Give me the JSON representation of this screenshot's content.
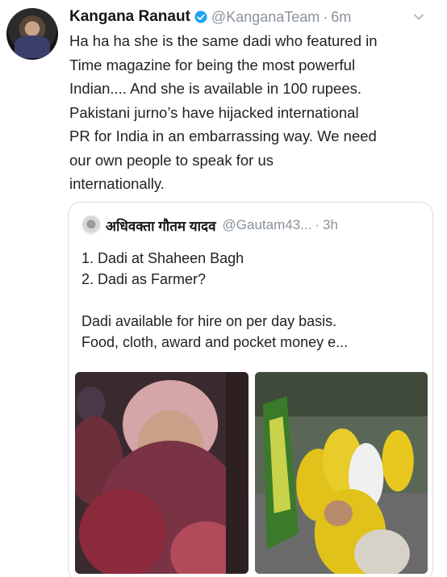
{
  "tweet": {
    "author_name": "Kangana Ranaut",
    "author_handle": "@KanganaTeam",
    "separator": "·",
    "time": "6m",
    "text_lines": [
      "Ha ha ha she is the same dadi who featured in",
      "Time magazine for being the most powerful",
      "Indian.... And she is available in 100 rupees.",
      "Pakistani jurno’s have hijacked international",
      "PR for India in an embarrassing way. We need",
      "our own people to speak for us",
      "internationally."
    ]
  },
  "quoted": {
    "author_name": "अधिवक्ता गौतम यादव",
    "author_handle": "@Gautam43...",
    "separator": "·",
    "time": "3h",
    "lines": [
      "1. Dadi at Shaheen Bagh",
      "2. Dadi as Farmer?",
      "",
      "Dadi available for hire on per day basis.",
      "Food, cloth, award and pocket money e..."
    ]
  },
  "colors": {
    "verified": "#1da1f2",
    "muted": "#8a939b",
    "border": "#d6dde3"
  },
  "icons": {
    "verified": "verified-badge-icon",
    "more": "chevron-down-icon"
  }
}
